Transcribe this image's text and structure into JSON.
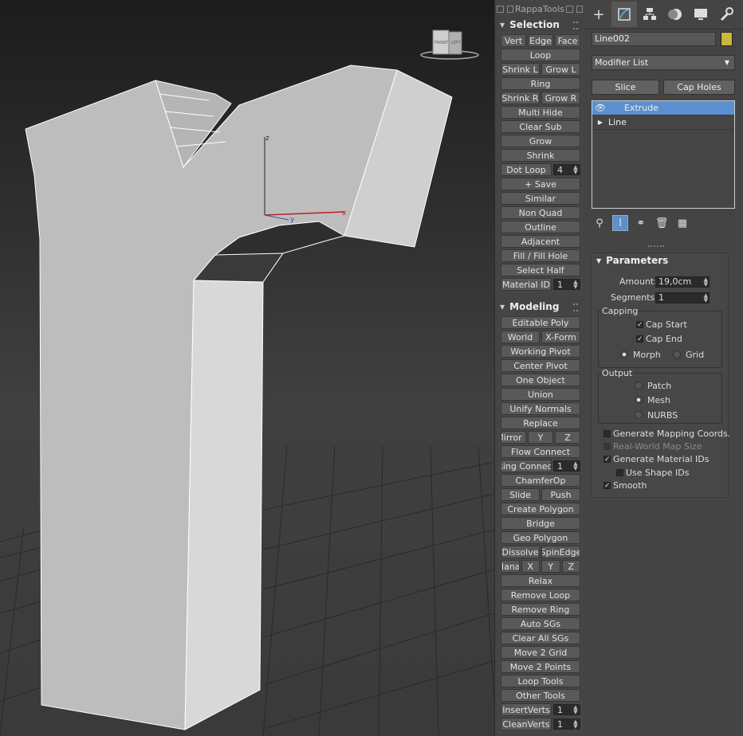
{
  "rappatools": {
    "title": "RappaTools",
    "selection": {
      "title": "Selection",
      "rows": [
        [
          "Vert",
          "Edge",
          "Face"
        ],
        [
          "Loop"
        ],
        [
          "Shrink L",
          "Grow L"
        ],
        [
          "Ring"
        ],
        [
          "Shrink R",
          "Grow R"
        ],
        [
          "Multi Hide"
        ],
        [
          "Clear Sub"
        ],
        [
          "Grow"
        ],
        [
          "Shrink"
        ],
        [
          "Dot Loop",
          {
            "spin": "4"
          }
        ],
        [
          "+ Save"
        ],
        [
          "Similar"
        ],
        [
          "Non Quad"
        ],
        [
          "Outline"
        ],
        [
          "Adjacent"
        ],
        [
          "Fill / Fill Hole"
        ],
        [
          "Select Half"
        ],
        [
          "Material ID",
          {
            "spin": "1"
          }
        ]
      ]
    },
    "modeling": {
      "title": "Modeling",
      "rows": [
        [
          "Editable Poly"
        ],
        [
          "World",
          "X-Form"
        ],
        [
          "Working Pivot"
        ],
        [
          "Center Pivot"
        ],
        [
          "One Object"
        ],
        [
          "Union"
        ],
        [
          "Unify Normals"
        ],
        [
          "Replace"
        ],
        [
          "Mirror X",
          "Y",
          "Z"
        ],
        [
          "Flow Connect"
        ],
        [
          "Ring Connect",
          {
            "spin": "1"
          }
        ],
        [
          "ChamferOp"
        ],
        [
          "Slide",
          "Push"
        ],
        [
          "Create Polygon"
        ],
        [
          "Bridge"
        ],
        [
          "Geo Polygon"
        ],
        [
          "Dissolve",
          "SpinEdge"
        ],
        [
          "Planar",
          "X",
          "Y",
          "Z"
        ],
        [
          "Relax"
        ],
        [
          "Remove Loop"
        ],
        [
          "Remove Ring"
        ],
        [
          "Auto SGs"
        ],
        [
          "Clear All SGs"
        ],
        [
          "Move 2 Grid"
        ],
        [
          "Move 2 Points"
        ],
        [
          "Loop Tools"
        ],
        [
          "Other Tools"
        ],
        [
          "InsertVerts",
          {
            "spin": "1"
          }
        ],
        [
          "CleanVerts",
          {
            "spin": "1"
          }
        ]
      ]
    }
  },
  "viewport": {
    "viewcube_labels": [
      "FRONT",
      "LEFT"
    ],
    "axes": {
      "x": "x",
      "y": "y",
      "z": "z"
    }
  },
  "command_panel": {
    "tabs": [
      "create-tab",
      "modify-tab",
      "hierarchy-tab",
      "motion-tab",
      "display-tab",
      "utilities-tab"
    ],
    "object_name": "Line002",
    "object_color": "#cbb73a",
    "modifier_list": "Modifier List",
    "buttons": {
      "slice": "Slice",
      "cap_holes": "Cap Holes"
    },
    "stack": [
      {
        "label": "Extrude",
        "selected": true
      },
      {
        "label": "Line",
        "selected": false
      }
    ],
    "parameters": {
      "title": "Parameters",
      "amount_label": "Amount:",
      "amount_value": "19,0cm",
      "segments_label": "Segments:",
      "segments_value": "1",
      "capping_label": "Capping",
      "cap_start": "Cap Start",
      "cap_end": "Cap End",
      "morph": "Morph",
      "grid": "Grid",
      "output_label": "Output",
      "patch": "Patch",
      "mesh": "Mesh",
      "nurbs": "NURBS",
      "gen_mapping": "Generate Mapping Coords.",
      "real_world": "Real-World Map Size",
      "gen_material": "Generate Material IDs",
      "use_shape": "Use Shape IDs",
      "smooth": "Smooth"
    }
  }
}
